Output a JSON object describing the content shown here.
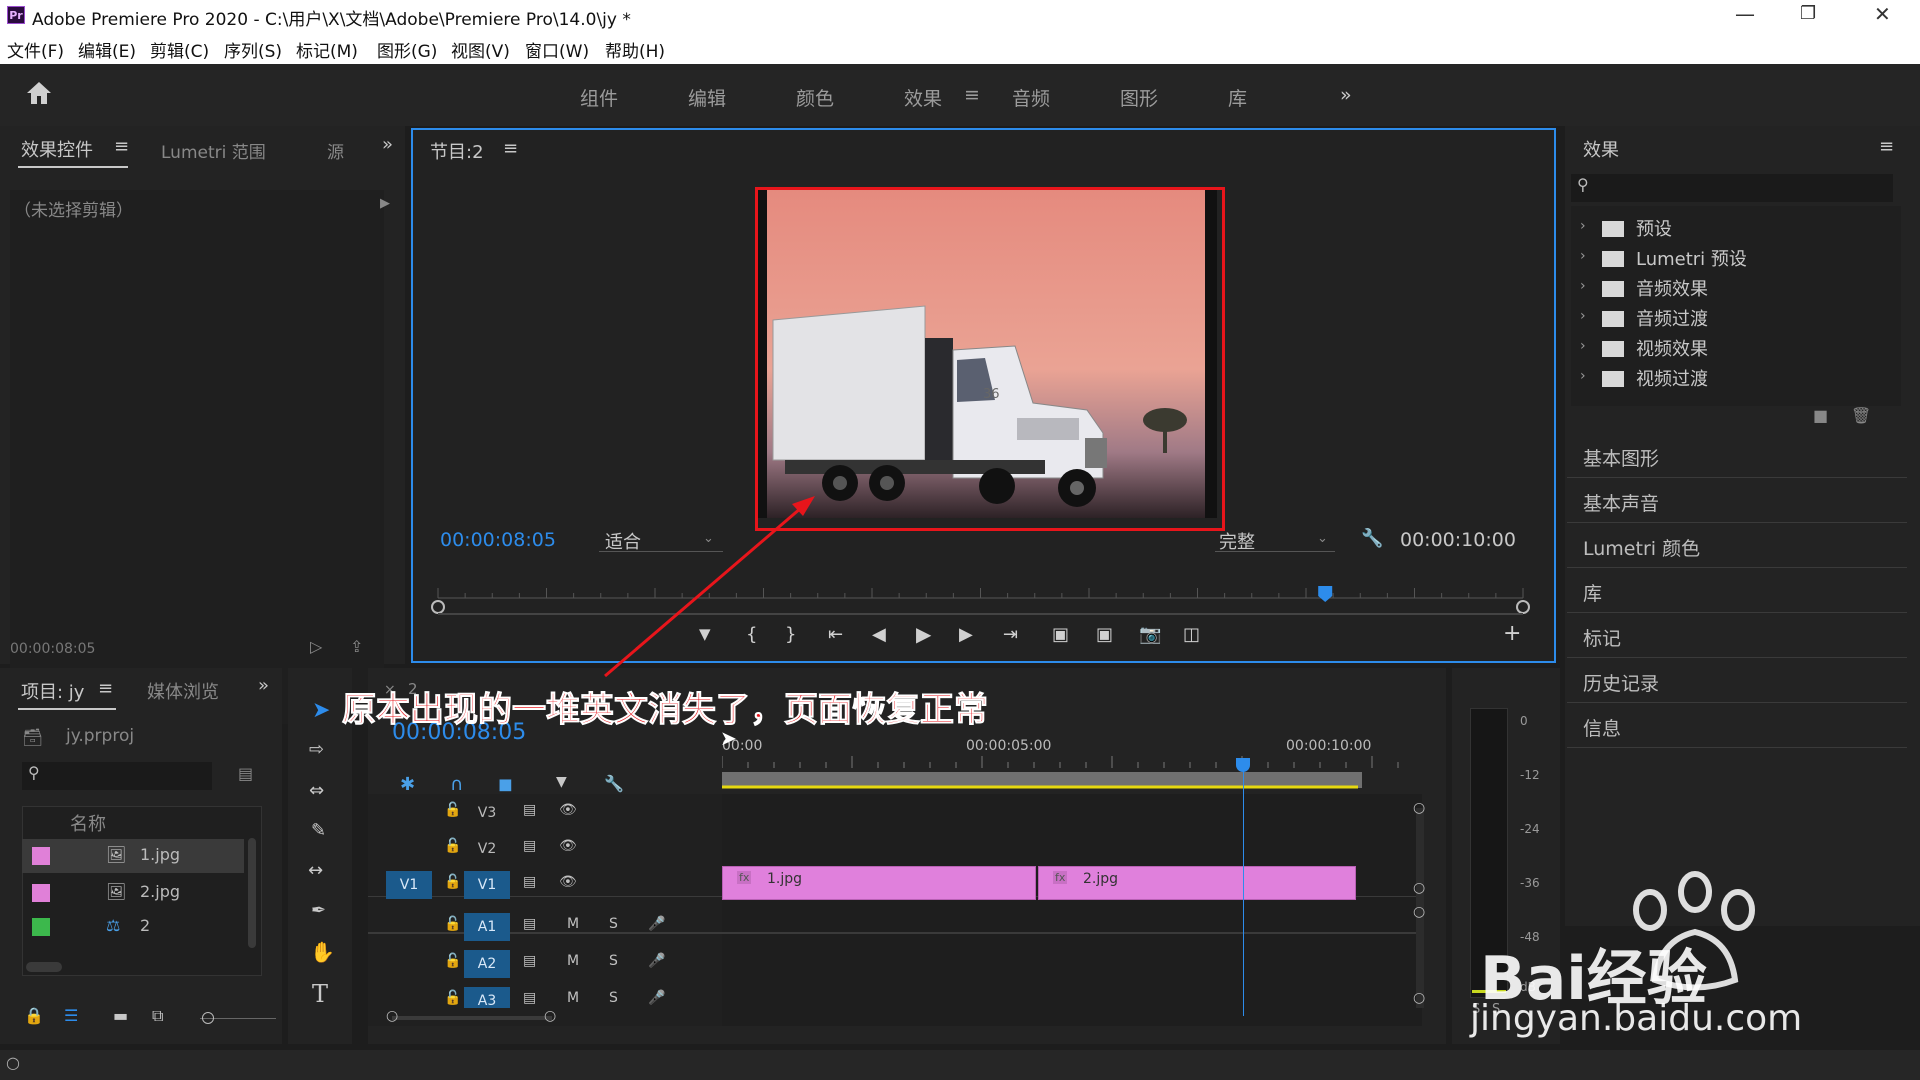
{
  "window": {
    "title": "Adobe Premiere Pro 2020 - C:\\用户\\X\\文档\\Adobe\\Premiere Pro\\14.0\\jy *",
    "app_icon": "Pr"
  },
  "menu": [
    "文件(F)",
    "编辑(E)",
    "剪辑(C)",
    "序列(S)",
    "标记(M)",
    "图形(G)",
    "视图(V)",
    "窗口(W)",
    "帮助(H)"
  ],
  "workspaces": [
    "组件",
    "编辑",
    "颜色",
    "效果",
    "音频",
    "图形",
    "库"
  ],
  "active_workspace": "效果",
  "effect_controls": {
    "tabs": [
      "效果控件",
      "Lumetri 范围",
      "源"
    ],
    "no_clip": "（未选择剪辑）",
    "timecode": "00:00:08:05"
  },
  "program": {
    "title": "节目:2",
    "timecode": "00:00:08:05",
    "fit": "适合",
    "quality": "完整",
    "duration": "00:00:10:00",
    "playhead_fraction": 0.8177,
    "truck_number": "36"
  },
  "effects_panel": {
    "title": "效果",
    "items": [
      "预设",
      "Lumetri 预设",
      "音频效果",
      "音频过渡",
      "视频效果",
      "视频过渡"
    ],
    "side_panels": [
      "基本图形",
      "基本声音",
      "Lumetri 颜色",
      "库",
      "标记",
      "历史记录",
      "信息"
    ]
  },
  "project": {
    "tabs": [
      "项目: jy",
      "媒体浏览"
    ],
    "file": "jy.prproj",
    "column_name": "名称",
    "items": [
      {
        "name": "1.jpg",
        "color": "#e080d8"
      },
      {
        "name": "2.jpg",
        "color": "#e080d8"
      },
      {
        "name": "2",
        "color": "#3cb84c"
      }
    ]
  },
  "timeline": {
    "tab": "2",
    "timecode": "00:00:08:05",
    "ruler": [
      "00:00",
      "00:00:05:00",
      "00:00:10:00"
    ],
    "tracks": [
      {
        "label": "V3",
        "src": ""
      },
      {
        "label": "V2",
        "src": ""
      },
      {
        "label": "V1",
        "src": "V1"
      },
      {
        "label": "A1",
        "m": "M",
        "s": "S"
      },
      {
        "label": "A2",
        "m": "M",
        "s": "S"
      },
      {
        "label": "A3",
        "m": "M",
        "s": "S"
      }
    ],
    "clips": [
      {
        "name": "1.jpg",
        "fx": "fx"
      },
      {
        "name": "2.jpg",
        "fx": "fx"
      }
    ]
  },
  "meter": {
    "ticks": [
      "0",
      "-12",
      "-24",
      "-36",
      "-48"
    ],
    "unit": "dB",
    "left": "S",
    "right": "S"
  },
  "annotation": "原本出现的一堆英文消失了，页面恢复正常",
  "watermark": {
    "text": "Bai经验",
    "url": "jingyan.baidu.com"
  },
  "colors": {
    "accent": "#2d8ceb",
    "annotation_red": "#e8151b",
    "clip": "#e080dc",
    "track_blue": "#1b5a8c"
  }
}
